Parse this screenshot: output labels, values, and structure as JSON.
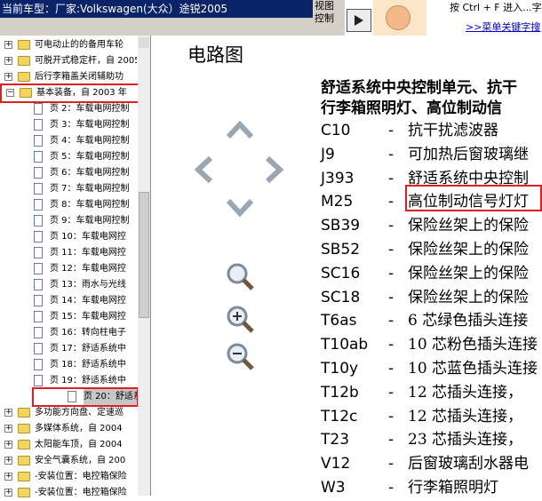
{
  "header": {
    "vehicle_label": "当前车型：厂家:Volkswagen(大众）途锐2005",
    "view_control": [
      "视图",
      "控制"
    ],
    "help_text": "按 Ctrl + F 进入...字！",
    "help_link": ">>菜单关键字搜"
  },
  "tree": {
    "items": [
      {
        "type": "folder",
        "label": "可电动止的的备用车轮"
      },
      {
        "type": "folder",
        "label": "可脱开式稳定杆，自 2005"
      },
      {
        "type": "folder",
        "label": "后行李箱盖关闭辅助功"
      },
      {
        "type": "folder",
        "label": "基本装备，自 2003 年",
        "open": true
      },
      {
        "type": "doc",
        "label": "页 2：车载电网控制"
      },
      {
        "type": "doc",
        "label": "页 3：车载电网控制"
      },
      {
        "type": "doc",
        "label": "页 4：车载电网控制"
      },
      {
        "type": "doc",
        "label": "页 5：车载电网控制"
      },
      {
        "type": "doc",
        "label": "页 6：车载电网控制"
      },
      {
        "type": "doc",
        "label": "页 7：车载电网控制"
      },
      {
        "type": "doc",
        "label": "页 8：车载电网控制"
      },
      {
        "type": "doc",
        "label": "页 9：车载电网控制"
      },
      {
        "type": "doc",
        "label": "页 10：车载电网控"
      },
      {
        "type": "doc",
        "label": "页 11：车载电网控"
      },
      {
        "type": "doc",
        "label": "页 12：车载电网控"
      },
      {
        "type": "doc",
        "label": "页 13：雨水与光线"
      },
      {
        "type": "doc",
        "label": "页 14：车载电网控"
      },
      {
        "type": "doc",
        "label": "页 15：车载电网控"
      },
      {
        "type": "doc",
        "label": "页 16：转向柱电子"
      },
      {
        "type": "doc",
        "label": "页 17：舒适系统中"
      },
      {
        "type": "doc",
        "label": "页 18：舒适系统中"
      },
      {
        "type": "doc",
        "label": "页 19：舒适系统中"
      },
      {
        "type": "doc",
        "label": "页 20：舒适系统中",
        "selected": true
      },
      {
        "type": "folder",
        "label": "多功能方向盘、定速巡"
      },
      {
        "type": "folder",
        "label": "多媒体系统，自 2004"
      },
      {
        "type": "folder",
        "label": "太阳能车顶，自 2004"
      },
      {
        "type": "folder",
        "label": "安全气囊系统，自 200"
      },
      {
        "type": "folder",
        "label": "-安装位置：电控箱保险"
      },
      {
        "type": "folder",
        "label": "-安装位置：电控箱保险"
      }
    ]
  },
  "content": {
    "title": "电路图",
    "heading_line1": "舒适系统中央控制单元、抗干",
    "heading_line2": "行李箱照明灯、高位制动信",
    "components": [
      {
        "code": "C10",
        "dash": "-",
        "desc": "抗干扰滤波器"
      },
      {
        "code": "J9",
        "dash": "-",
        "desc": "可加热后窗玻璃继"
      },
      {
        "code": "J393",
        "dash": "-",
        "desc": "舒适系统中央控制"
      },
      {
        "code": "M25",
        "dash": "-",
        "desc": "高位制动信号灯灯"
      },
      {
        "code": "SB39",
        "dash": "-",
        "desc": "保险丝架上的保险"
      },
      {
        "code": "SB52",
        "dash": "-",
        "desc": "保险丝架上的保险"
      },
      {
        "code": "SC16",
        "dash": "-",
        "desc": "保险丝架上的保险"
      },
      {
        "code": "SC18",
        "dash": "-",
        "desc": "保险丝架上的保险"
      },
      {
        "code": "T6as",
        "dash": "-",
        "desc": "6 芯绿色插头连接"
      },
      {
        "code": "T10ab",
        "dash": "-",
        "desc": "10 芯粉色插头连接"
      },
      {
        "code": "T10y",
        "dash": "-",
        "desc": "10 芯蓝色插头连接"
      },
      {
        "code": "T12b",
        "dash": "-",
        "desc": "12 芯插头连接，"
      },
      {
        "code": "T12c",
        "dash": "-",
        "desc": "12 芯插头连接，"
      },
      {
        "code": "T23",
        "dash": "-",
        "desc": "23 芯插头连接，"
      },
      {
        "code": "V12",
        "dash": "-",
        "desc": "后窗玻璃刮水器电"
      },
      {
        "code": "W3",
        "dash": "-",
        "desc": "行李箱照明灯"
      }
    ]
  }
}
